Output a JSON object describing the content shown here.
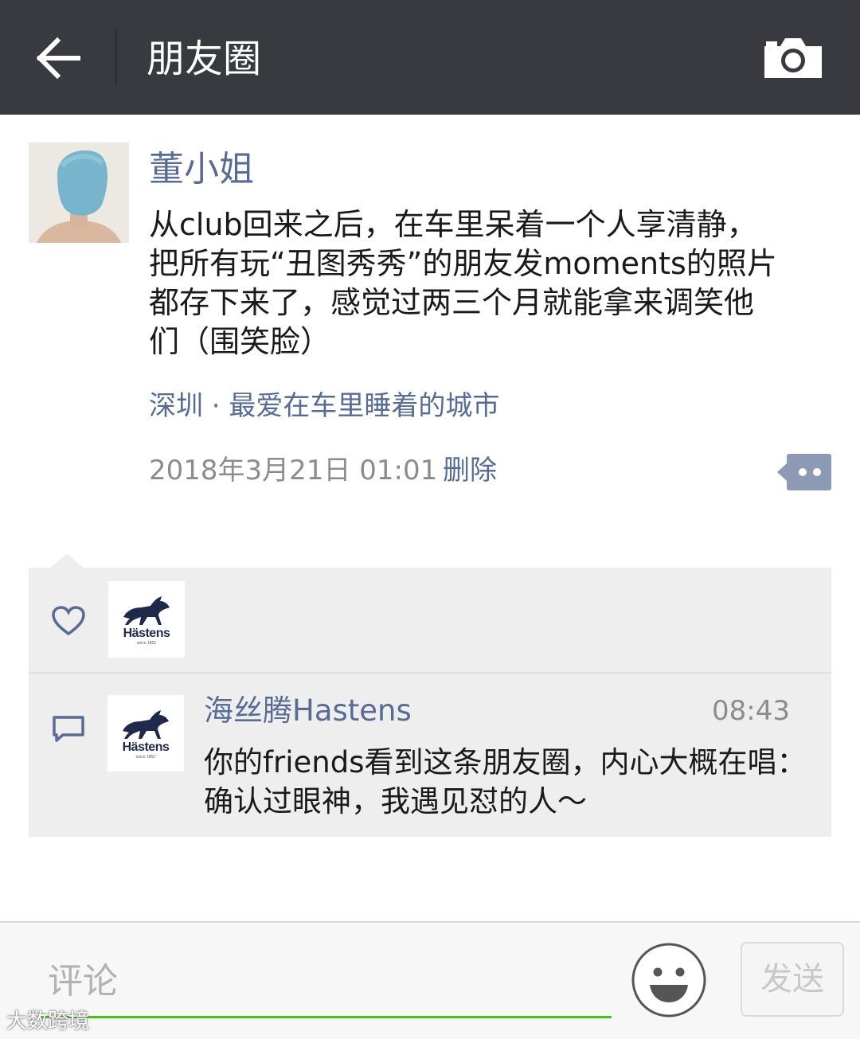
{
  "header": {
    "title": "朋友圈",
    "back_icon": "arrow-left-icon",
    "camera_icon": "camera-icon"
  },
  "post": {
    "author": "董小姐",
    "text": "从club回来之后，在车里呆着一个人享清静，\n把所有玩“丑图秀秀”的朋友发moments的照片\n都存下来了，感觉过两三个月就能拿来调笑他\n们（围笑脸）",
    "location": "深圳 · 最爱在车里睡着的城市",
    "time": "2018年3月21日 01:01",
    "delete_label": "删除"
  },
  "likes": {
    "icon": "heart-icon",
    "liker_logo_text": "Hästens",
    "liker_logo_sub": "since 1852"
  },
  "comments": [
    {
      "name": "海丝腾Hastens",
      "time": "08:43",
      "text": "你的friends看到这条朋友圈，内心大概在唱：确认过眼神，我遇见怼的人～",
      "logo_text": "Hästens",
      "logo_sub": "since 1852"
    }
  ],
  "input_bar": {
    "placeholder": "评论",
    "send_label": "发送",
    "emoji_icon": "smiley-face-icon"
  },
  "watermark": "大数跨境",
  "colors": {
    "header_bg": "#393a3f",
    "link_blue": "#576b95",
    "panel_bg": "#eeeeee",
    "accent_green": "#45c01a"
  }
}
